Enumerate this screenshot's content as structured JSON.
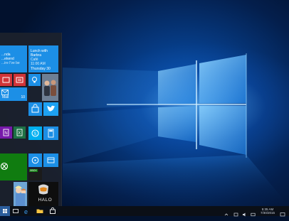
{
  "start_menu": {
    "calendar_tile": {
      "event": "Lunch with",
      "event_line2": "Barbra",
      "location": "Café",
      "time": "11:00 AM",
      "date": "Thursday 30"
    },
    "mail_tile": {
      "text_line1": "...nda",
      "text_line2": "...ekend",
      "text_line3": "...ire I've be",
      "label": "Mail",
      "count": "10"
    },
    "xbox_badge": "XBOX"
  },
  "taskbar": {
    "clock_time": "5:35 AM",
    "clock_date": "7/30/2015"
  },
  "colors": {
    "tile_blue": "#1c8fe6",
    "tile_green": "#107c10",
    "tile_red": "#d13438",
    "tile_purple": "#7719aa",
    "tile_excel": "#1e7145",
    "tile_skype": "#00aff0"
  }
}
